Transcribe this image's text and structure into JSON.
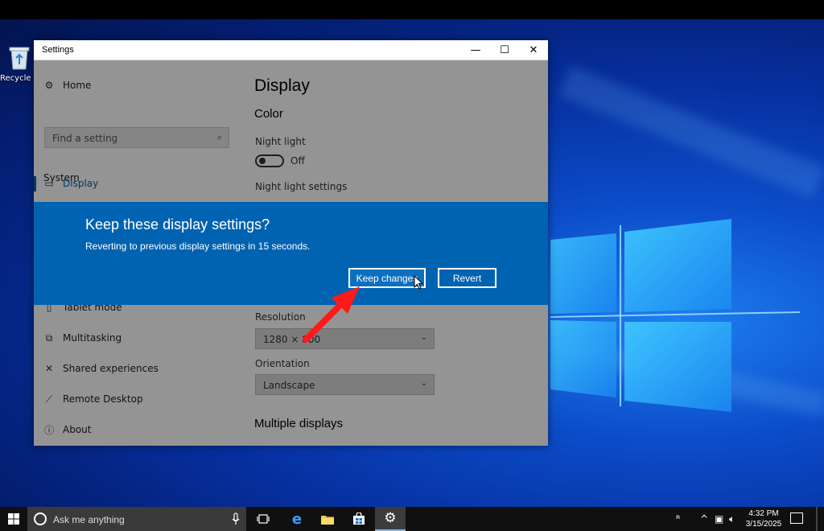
{
  "desktop": {
    "recycle_bin_label": "Recycle Bin"
  },
  "window": {
    "title": "Settings",
    "controls": {
      "minimize": "—",
      "maximize": "☐",
      "close": "✕"
    }
  },
  "sidebar": {
    "home": "Home",
    "search_placeholder": "Find a setting",
    "section": "System",
    "items": [
      {
        "label": "Display",
        "icon": "monitor-icon",
        "active": true
      },
      {
        "label": "Tablet mode",
        "icon": "tablet-icon"
      },
      {
        "label": "Multitasking",
        "icon": "multitasking-icon"
      },
      {
        "label": "Shared experiences",
        "icon": "shared-icon"
      },
      {
        "label": "Remote Desktop",
        "icon": "remote-icon"
      },
      {
        "label": "About",
        "icon": "info-icon"
      }
    ]
  },
  "main": {
    "heading": "Display",
    "color_heading": "Color",
    "night_light_label": "Night light",
    "night_light_state": "Off",
    "night_light_settings": "Night light settings",
    "resolution_label": "Resolution",
    "resolution_value": "1280 × 800",
    "orientation_label": "Orientation",
    "orientation_value": "Landscape",
    "multiple_displays": "Multiple displays"
  },
  "dialog": {
    "title": "Keep these display settings?",
    "message": "Reverting to previous display settings in 15 seconds.",
    "keep_label": "Keep changes",
    "revert_label": "Revert"
  },
  "taskbar": {
    "search_text": "Ask me anything",
    "time": "4:32 PM",
    "date": "3/15/2025"
  },
  "colors": {
    "accent": "#0063b1",
    "arrow": "#ff1a1a"
  }
}
